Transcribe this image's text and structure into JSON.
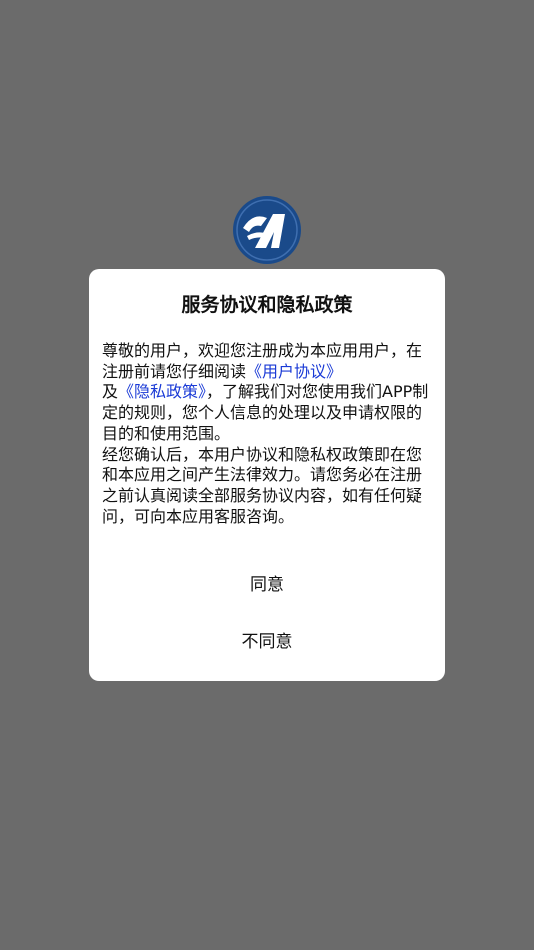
{
  "logo": {
    "icon": "app-logo-icon",
    "color": "#1a4a8a"
  },
  "dialog": {
    "title": "服务协议和隐私政策",
    "body": {
      "part1": "尊敬的用户，欢迎您注册成为本应用用户，在注册前请您仔细阅读",
      "link_user_agreement": "《用户协议》",
      "part2": "及",
      "link_privacy_policy": "《隐私政策》",
      "part3": "，了解我们对您使用我们APP制定的规则，您个人信息的处理以及申请权限的目的和使用范围。",
      "part4": "经您确认后，本用户协议和隐私权政策即在您和本应用之间产生法律效力。请您务必在注册之前认真阅读全部服务协议内容，如有任何疑问，可向本应用客服咨询。"
    },
    "agree_label": "同意",
    "disagree_label": "不同意",
    "link_color": "#1a3ad6"
  },
  "overlay_color": "#6b6b6b"
}
